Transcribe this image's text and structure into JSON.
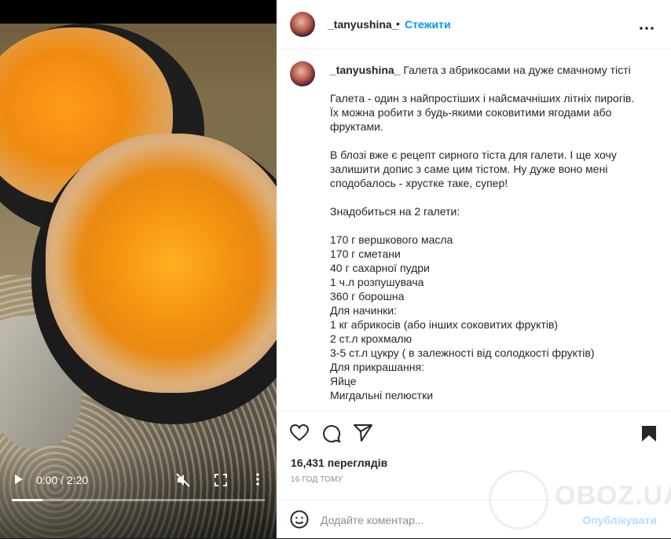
{
  "post": {
    "username": "_tanyushina_",
    "follow_label": "Стежити",
    "separator": "•",
    "more_label": "•••"
  },
  "caption": {
    "username": "_tanyushina_",
    "first_line": "Галета з абрикосами на дуже смачному тісті",
    "paragraph1": [
      "Галета - один з найпростіших і найсмачніших літніх пирогів.",
      "Їх можна робити з будь-якими соковитими ягодами або",
      "фруктами."
    ],
    "paragraph2": [
      "В блозі вже є рецепт сирного тіста для галети. І ще хочу",
      "залишити допис з саме цим тістом. Ну дуже воно мені",
      "сподобалось - хрустке таке, супер!"
    ],
    "paragraph3": [
      "Знадобиться на 2 галети:"
    ],
    "ingredients": [
      "170 г вершкового масла",
      "170 г сметани",
      "40 г сахарної пудри",
      "1 ч.л розпушувача",
      "360 г борошна",
      "Для начинки:",
      "1 кг абрикосів (або інших соковитих фруктів)",
      "2 ст.л крохмалю",
      "3-5 ст.л цукру ( в залежності від солодкості фруктів)",
      "Для прикрашання:",
      "Яйце",
      "Мигдальні пелюстки"
    ]
  },
  "video": {
    "time": "0:00 / 2:20",
    "progress": 0.12
  },
  "stats": {
    "views": "16,431 переглядів",
    "posted": "16 ГОД ТОМУ"
  },
  "comment": {
    "placeholder": "Додайте коментар...",
    "post_label": "Опублікувати"
  },
  "watermark": {
    "text": "OBOZ.UA"
  },
  "icons": {
    "like": "heart-icon",
    "comment": "comment-icon",
    "share": "send-icon",
    "save": "bookmark-icon",
    "emoji": "emoji-icon",
    "play": "play-icon",
    "mute": "mute-icon",
    "fullscreen": "fullscreen-icon",
    "menu": "more-vertical-icon"
  },
  "colors": {
    "accent": "#0095f6",
    "text": "#262626",
    "muted": "#8e8e8e"
  }
}
